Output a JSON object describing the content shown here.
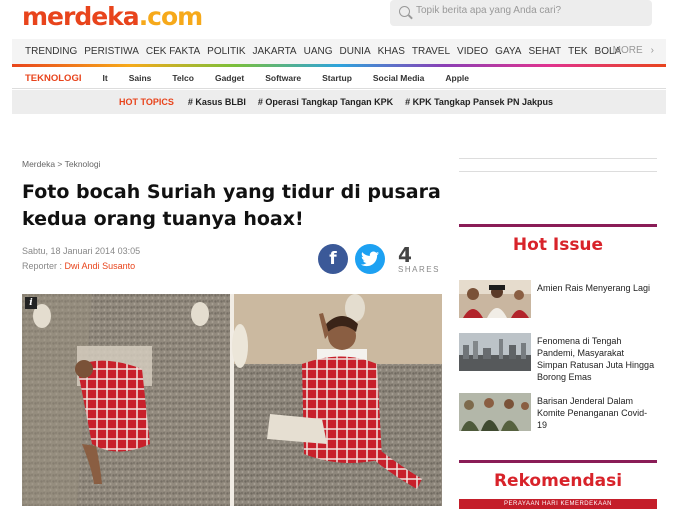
{
  "header": {
    "logo_part1": "merdeka",
    "logo_part2": ".com",
    "search_placeholder": "Topik berita apa yang Anda cari?"
  },
  "nav": {
    "items": [
      "TRENDING",
      "PERISTIWA",
      "CEK FAKTA",
      "POLITIK",
      "JAKARTA",
      "UANG",
      "DUNIA",
      "KHAS",
      "TRAVEL",
      "VIDEO",
      "GAYA",
      "SEHAT",
      "TEK",
      "BOLA"
    ],
    "more_label": "MORE",
    "more_icon": "chevron-right-icon"
  },
  "subnav": {
    "active": "TEKNOLOGI",
    "items": [
      "It",
      "Sains",
      "Telco",
      "Gadget",
      "Software",
      "Startup",
      "Social Media",
      "Apple"
    ]
  },
  "hot_topics": {
    "label": "HOT TOPICS",
    "tags": [
      "# Kasus BLBI",
      "# Operasi Tangkap Tangan KPK",
      "# KPK Tangkap Pansek PN Jakpus"
    ]
  },
  "article": {
    "breadcrumb": "Merdeka > Teknologi",
    "title": "Foto bocah Suriah yang tidur di pusara kedua orang tuanya hoax!",
    "date": "Sabtu, 18 Januari 2014 03:05",
    "reporter_label": "Reporter :",
    "reporter_name": "Dwi Andi Susanto",
    "share_count": "4",
    "share_label": "SHARES",
    "info_badge": "i"
  },
  "sidebar": {
    "hot_issue_title": "Hot Issue",
    "hot_issues": [
      "Amien Rais Menyerang Lagi",
      "Fenomena di Tengah Pandemi, Masyarakat Simpan Ratusan Juta Hingga Borong Emas",
      "Barisan Jenderal Dalam Komite Penanganan Covid-19"
    ],
    "rekomendasi_title": "Rekomendasi",
    "rekom_banner": "PERAYAAN HARI KEMERDEKAAN"
  },
  "colors": {
    "brand_red": "#e8441c",
    "brand_orange": "#f6a91a",
    "facebook": "#3b5998",
    "twitter": "#1da1f2",
    "section_red": "#d8232a",
    "section_border": "#8a1c57"
  }
}
